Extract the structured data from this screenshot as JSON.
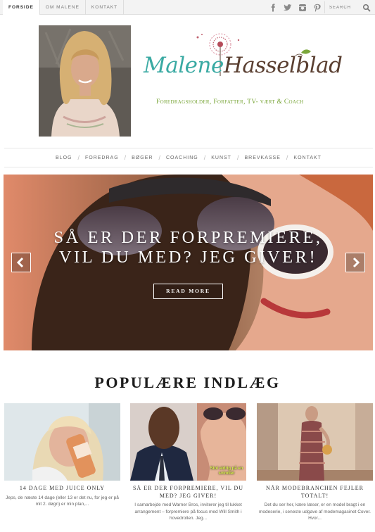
{
  "topbar": {
    "nav": [
      {
        "label": "FORSIDE",
        "active": true
      },
      {
        "label": "OM MALENE",
        "active": false
      },
      {
        "label": "KONTAKT",
        "active": false
      }
    ],
    "social_icons": [
      "facebook-icon",
      "twitter-icon",
      "instagram-icon",
      "pinterest-icon"
    ],
    "search_placeholder": "SEARCH"
  },
  "header": {
    "logo_first": "Malene",
    "logo_last": "Hasselblad",
    "tagline": "Foredragsholder, Forfatter, TV- vært & Coach"
  },
  "mainnav": {
    "items": [
      "BLOG",
      "FOREDRAG",
      "BØGER",
      "COACHING",
      "KUNST",
      "BREVKASSE",
      "KONTAKT"
    ],
    "separator": "/"
  },
  "hero": {
    "title_line1": "SÅ ER DER FORPREMIERE,",
    "title_line2": "VIL DU MED? JEG GIVER!",
    "button": "READ MORE"
  },
  "popular": {
    "title": "POPULÆRE INDLÆG",
    "posts": [
      {
        "title": "14 DAGE MED JUICE ONLY",
        "excerpt": "Jeps, de næste 14 dage (eller 13 er det nu, for jeg er på mit 2. døgn) er min plan,..."
      },
      {
        "title": "SÅ ER DER FORPREMIERE, VIL DU MED? JEG GIVER!",
        "excerpt": "I samarbejde med Warner Bros, inviterer jeg til lukket arrangement – forpremiere på focus med Will Smith i hovedrollen. Jeg...",
        "image_caption": "Stol aldrig på en svindler"
      },
      {
        "title": "NÅR MODEBRANCHEN FEJLER TOTALT!",
        "excerpt": "Det du ser her, kære læser, er en model bragt i en modeserie, i seneste udgave af modemagasinet Cover. Hvor..."
      }
    ]
  },
  "colors": {
    "logo_teal": "#3aaaa3",
    "logo_brown": "#5a3f31",
    "tagline_green": "#7aa63a"
  }
}
